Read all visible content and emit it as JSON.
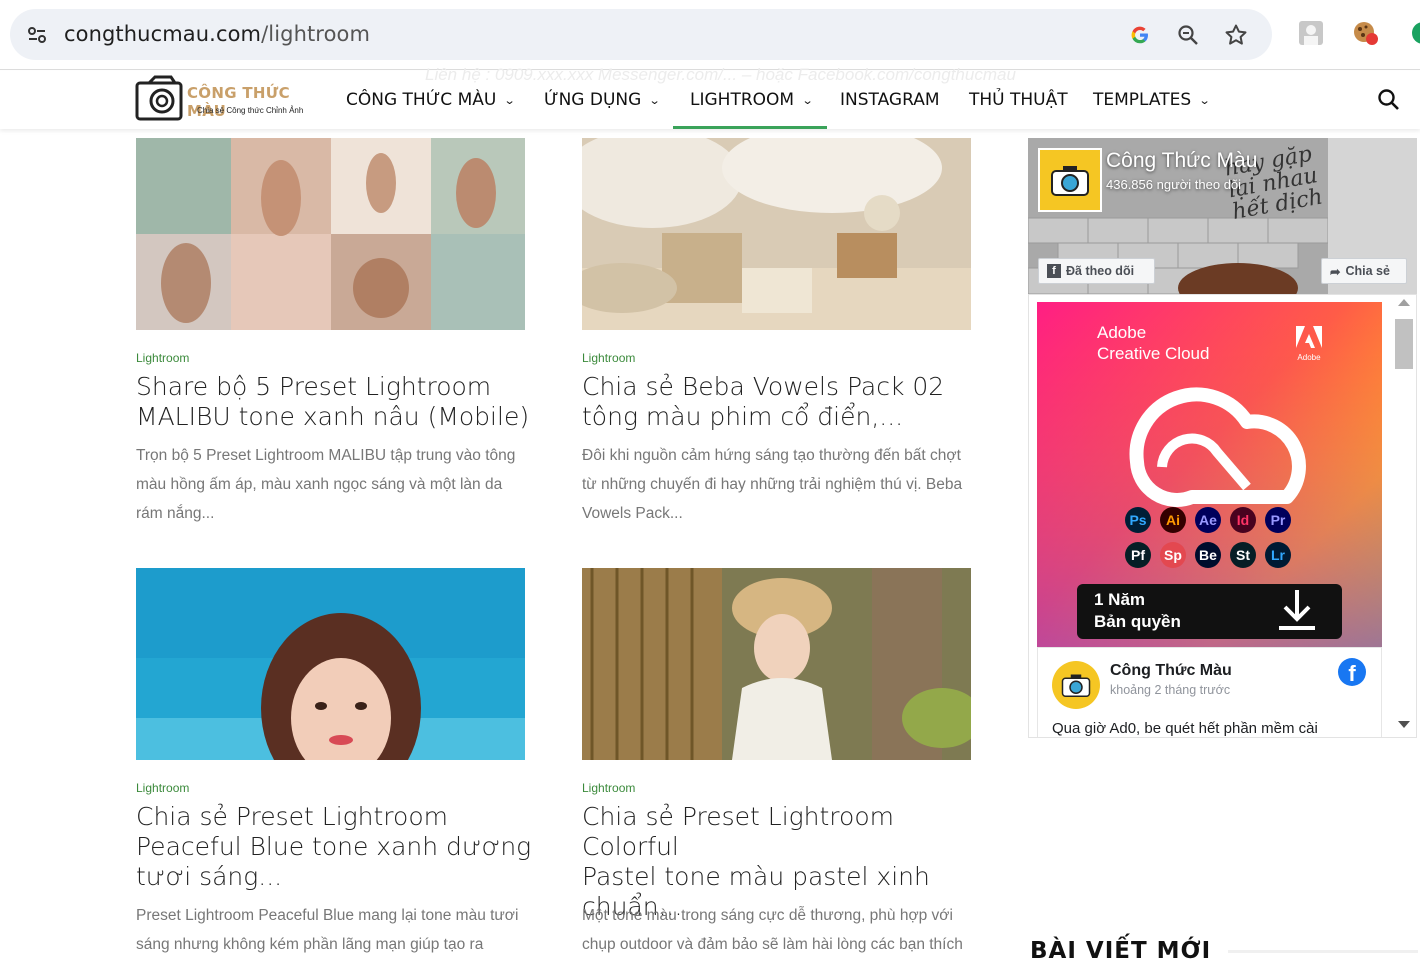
{
  "browser": {
    "url_host": "congthucmau.com",
    "url_path": "/lightroom"
  },
  "site": {
    "faded_banner": "Liên hệ : 0909.xxx.xxx Messenger.com/... – hoặc Facebook.com/congthucmau",
    "logo_title": "CÔNG THỨC MÀU",
    "logo_subtitle": "Chia sẻ Công thức Chỉnh Ảnh",
    "menu": [
      {
        "label": "CÔNG THỨC MÀU",
        "has_dropdown": true
      },
      {
        "label": "ỨNG DỤNG",
        "has_dropdown": true
      },
      {
        "label": "LIGHTROOM",
        "has_dropdown": true,
        "active": true
      },
      {
        "label": "INSTAGRAM",
        "has_dropdown": false
      },
      {
        "label": "THỦ THUẬT",
        "has_dropdown": false
      },
      {
        "label": "TEMPLATES",
        "has_dropdown": true
      }
    ]
  },
  "articles": [
    {
      "category": "Lightroom",
      "title_lines": [
        "Share bộ 5 Preset Lightroom",
        "MALIBU tone xanh nâu (Mobile)"
      ],
      "excerpt_lines": [
        "Trọn bộ 5 Preset Lightroom MALIBU tập trung vào tông",
        "màu hồng ấm áp, màu xanh ngọc sáng và một làn da",
        "rám nắng..."
      ]
    },
    {
      "category": "Lightroom",
      "title_lines": [
        "Chia sẻ Beba Vowels Pack 02",
        "tông màu phim cổ điển,..."
      ],
      "excerpt_lines": [
        "Đôi khi nguồn cảm hứng sáng tạo thường đến bất chợt",
        "từ những chuyến đi hay những trải nghiệm thú vị. Beba",
        "Vowels Pack..."
      ]
    },
    {
      "category": "Lightroom",
      "title_lines": [
        "Chia sẻ Preset Lightroom",
        "Peaceful Blue tone xanh dương",
        "tươi sáng..."
      ],
      "excerpt_lines": [
        "Preset Lightroom Peaceful Blue mang lại tone màu tươi",
        "sáng nhưng không kém phần lãng mạn giúp tạo ra"
      ]
    },
    {
      "category": "Lightroom",
      "title_lines": [
        "Chia sẻ Preset Lightroom Colorful",
        "Pastel tone màu pastel xinh",
        "chuẩn..."
      ],
      "excerpt_lines": [
        "Một tone màu trong sáng cực dễ thương, phù hợp với",
        "chụp outdoor và đảm bảo sẽ làm hài lòng các bạn thích"
      ]
    }
  ],
  "sidebar": {
    "fb_page_name": "Công Thức Màu",
    "fb_followers": "436.856 người theo dõi",
    "fb_cover_text": "hay gặp lại nhau hết dịch",
    "fb_follow_button": "Đã theo dõi",
    "fb_share_button": "Chia sẻ",
    "ad_brand_line1": "Adobe",
    "ad_brand_line2": "Creative Cloud",
    "ad_adobe_label": "Adobe",
    "ad_apps": [
      "Ps",
      "Ai",
      "Ae",
      "Id",
      "Pr",
      "Pf",
      "Sp",
      "Be",
      "St",
      "Lr"
    ],
    "ad_badge_line1": "1 Năm",
    "ad_badge_line2": "Bản quyền",
    "post_author": "Công Thức Màu",
    "post_time": "khoảng 2 tháng trước",
    "post_text": "Qua giờ Ad0, be quét hết phần mềm cài",
    "heading": "BÀI VIẾT MỚI"
  },
  "colors": {
    "accent_green": "#3aa35a",
    "category_green": "#3b8a3b",
    "logo_gold": "#c9a06a",
    "fb_blue": "#1877f2"
  }
}
